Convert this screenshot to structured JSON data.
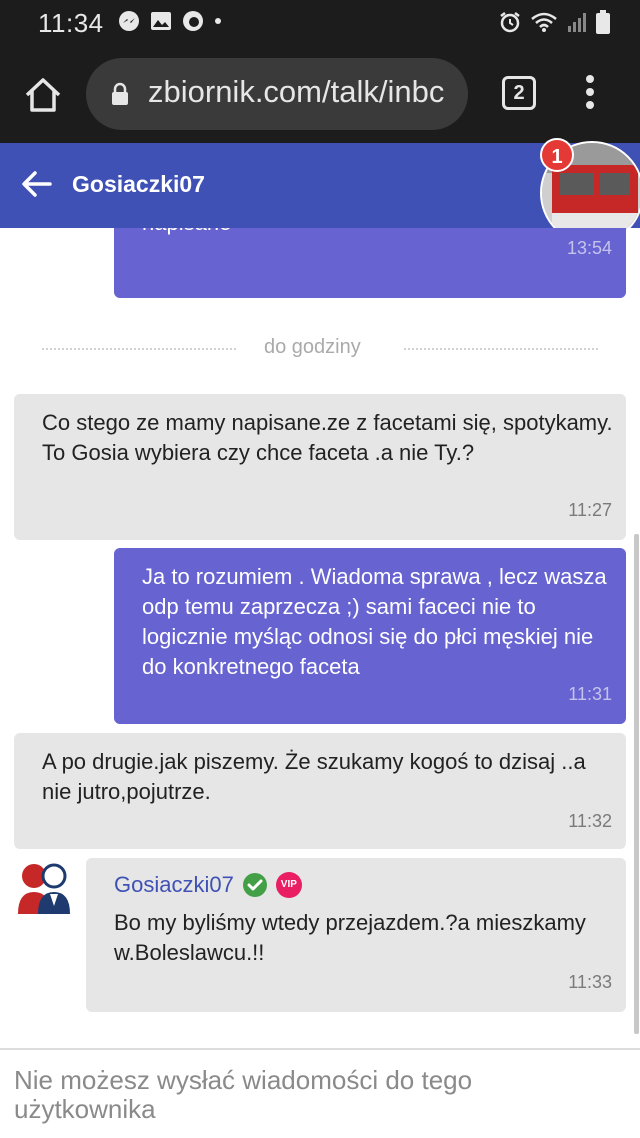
{
  "status_bar": {
    "time": "11:34"
  },
  "browser": {
    "url": "zbiornik.com/talk/inbc",
    "tab_count": "2"
  },
  "chat": {
    "title": "Gosiaczki07",
    "bubble_badge": "1",
    "divider_label": "do godziny",
    "messages": [
      {
        "direction": "out",
        "text": "napisane",
        "time": "13:54"
      },
      {
        "direction": "in",
        "text": "Co stego ze mamy napisane.ze z facetami się, spotykamy. To Gosia wybiera czy chce faceta .a nie Ty.?",
        "time": "11:27"
      },
      {
        "direction": "out",
        "text": "Ja to rozumiem . Wiadoma sprawa , lecz wasza odp temu zaprzecza ;) sami faceci nie to logicznie myśląc odnosi się do płci męskiej nie do konkretnego faceta",
        "time": "11:31"
      },
      {
        "direction": "in",
        "text": "A po drugie.jak piszemy. Że szukamy kogoś to dzisaj ..a nie jutro,pojutrze.",
        "time": "11:32"
      },
      {
        "direction": "in",
        "sender": "Gosiaczki07",
        "vip_label": "VIP",
        "text": "Bo my byliśmy wtedy przejazdem.?a mieszkamy w.Boleslawcu.!!",
        "time": "11:33"
      }
    ]
  },
  "footer": {
    "notice": "Nie możesz wysłać wiadomości do tego użytkownika"
  },
  "colors": {
    "header": "#3f51b5",
    "outgoing": "#6763d1",
    "incoming": "#e6e6e6",
    "verified": "#43a047",
    "vip": "#e91e63"
  }
}
